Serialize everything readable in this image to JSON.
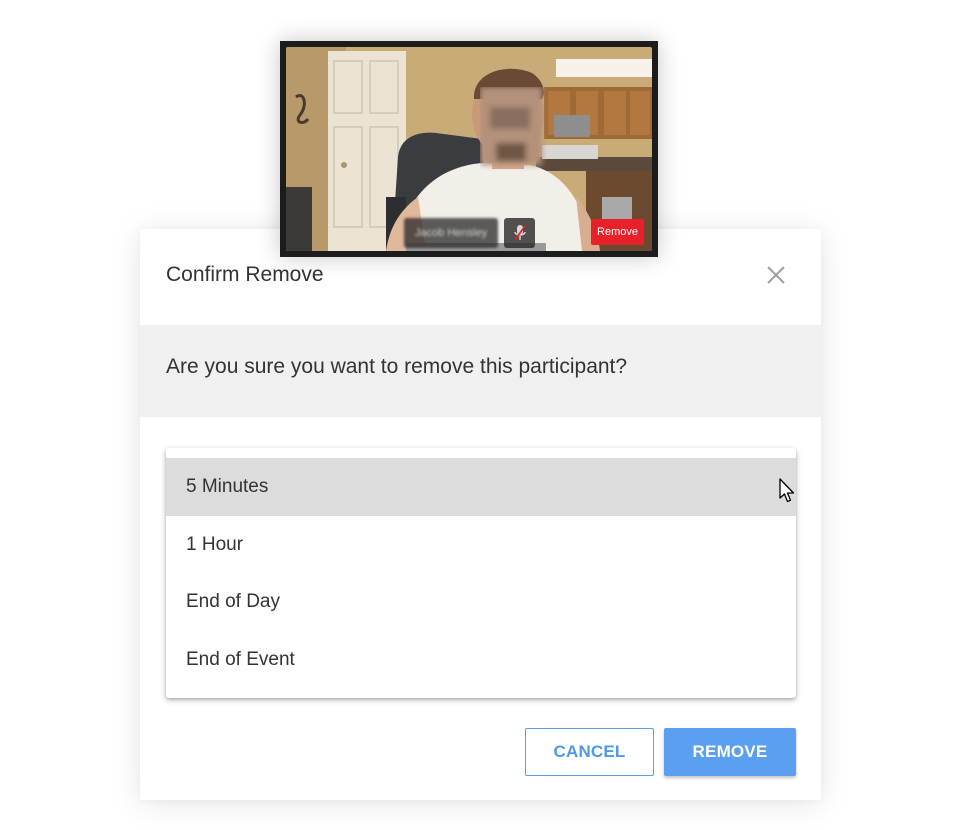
{
  "video_tile": {
    "participant_name": "Jacob Hensley",
    "remove_label": "Remove",
    "mic_state": "muted"
  },
  "dialog": {
    "title": "Confirm Remove",
    "message": "Are you sure you want to remove this participant?",
    "options": [
      {
        "label": "5 Minutes",
        "selected": true
      },
      {
        "label": "1 Hour",
        "selected": false
      },
      {
        "label": "End of Day",
        "selected": false
      },
      {
        "label": "End of Event",
        "selected": false
      }
    ],
    "cancel_label": "CANCEL",
    "remove_label": "REMOVE"
  },
  "colors": {
    "accent_blue": "#5b9ff0",
    "danger_red": "#e8202a",
    "message_band": "#f0f0f0",
    "selected_option": "#dcdcdc"
  }
}
